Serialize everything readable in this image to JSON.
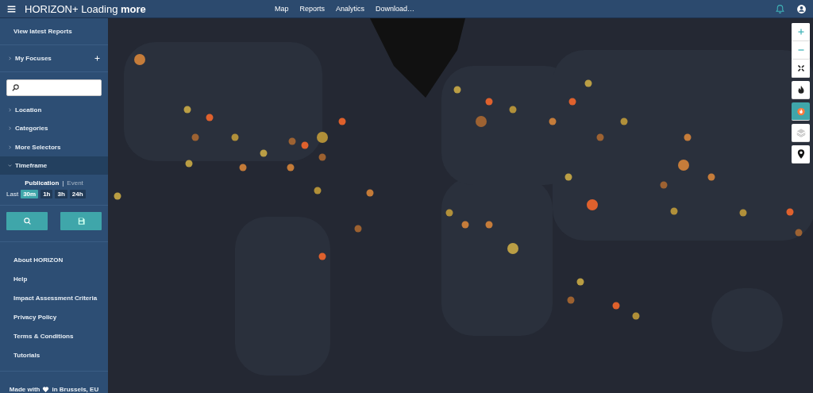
{
  "header": {
    "title": "HORIZON+ Loading **more**",
    "nav": [
      {
        "label": "Map"
      },
      {
        "label": "Reports"
      },
      {
        "label": "Analytics"
      },
      {
        "label": "Download…"
      }
    ]
  },
  "sidebar": {
    "view_latest": "View latest Reports",
    "focuses": {
      "label": "My Focuses",
      "expanded": false
    },
    "filters": [
      {
        "label": "Location",
        "expanded": false
      },
      {
        "label": "Categories",
        "expanded": false
      },
      {
        "label": "More Selectors",
        "expanded": false
      },
      {
        "label": "Timeframe",
        "expanded": true
      }
    ],
    "timeframe": {
      "modes": [
        {
          "label": "Publication",
          "selected": true
        },
        {
          "label": "Event",
          "selected": false
        }
      ],
      "separator": "|",
      "last_label": "Last",
      "ranges": [
        {
          "label": "30m",
          "selected": true
        },
        {
          "label": "1h",
          "selected": false
        },
        {
          "label": "3h",
          "selected": false
        },
        {
          "label": "24h",
          "selected": false
        }
      ]
    },
    "actions": [
      {
        "kind": "search"
      },
      {
        "kind": "save"
      }
    ],
    "links": [
      "About HORIZON",
      "Help",
      "Impact Assessment Criteria",
      "Privacy Policy",
      "Terms & Conditions",
      "Tutorials"
    ],
    "footer": {
      "before": "Made with",
      "after": "in Brussels, EU"
    }
  },
  "map": {
    "zoom_controls": [
      {
        "kind": "zoom-in"
      },
      {
        "kind": "zoom-out"
      },
      {
        "kind": "fullscreen"
      }
    ],
    "layers": [
      {
        "kind": "fire",
        "selected": false
      },
      {
        "kind": "heat",
        "selected": true
      },
      {
        "kind": "stack",
        "selected": false
      },
      {
        "kind": "pin",
        "selected": false
      }
    ]
  }
}
